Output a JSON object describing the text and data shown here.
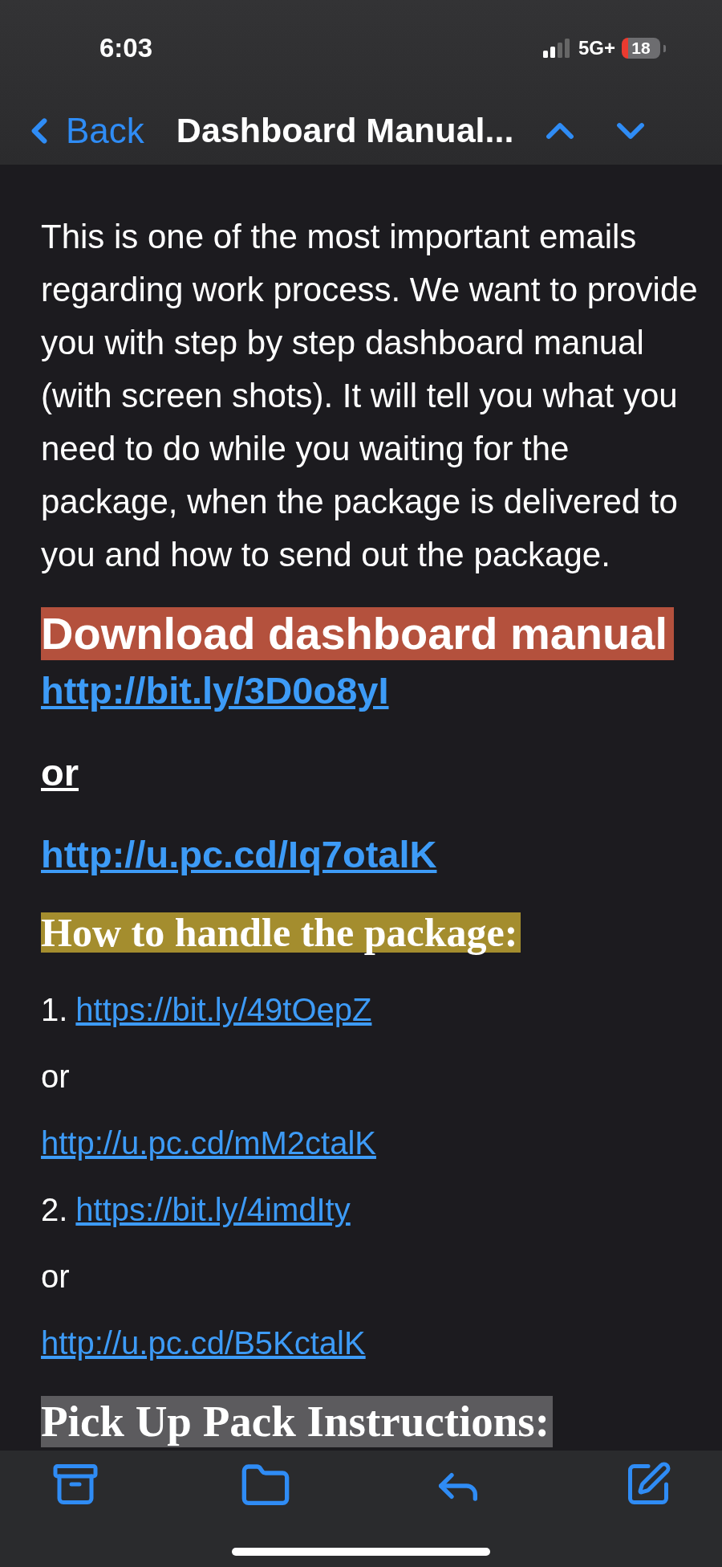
{
  "status_bar": {
    "time": "6:03",
    "network": "5G+",
    "battery": "18"
  },
  "nav": {
    "back": "Back",
    "title": "Dashboard Manual..."
  },
  "body": [
    {
      "kind": "paragraph",
      "text": "This is one of the most important emails regarding work process. We want to provide you with step by step dashboard manual (with screen shots). It will tell you what you need to do while you waiting for the package, when the package is delivered to you and how to send out the package."
    },
    {
      "kind": "sans_banner",
      "text": "Download dashboard manual",
      "color": "#b4513d"
    },
    {
      "kind": "link",
      "text": "http://bit.ly/3D0o8yI",
      "bold": true
    },
    {
      "kind": "text",
      "text": "or",
      "bold": true
    },
    {
      "kind": "link",
      "text": "http://u.pc.cd/Iq7otalK",
      "bold": true
    },
    {
      "kind": "serif_banner",
      "text": "How to handle the package:",
      "color": "#a48d2e"
    },
    {
      "kind": "numbered_link",
      "number": "1.",
      "text": "https://bit.ly/49tOepZ"
    },
    {
      "kind": "text",
      "text": "or",
      "bold": false
    },
    {
      "kind": "link",
      "text": "http://u.pc.cd/mM2ctalK",
      "bold": false
    },
    {
      "kind": "numbered_link",
      "number": "2.",
      "text": "https://bit.ly/4imdIty"
    },
    {
      "kind": "text",
      "text": "or",
      "bold": false
    },
    {
      "kind": "link",
      "text": "http://u.pc.cd/B5KctalK",
      "bold": false
    },
    {
      "kind": "serif_banner",
      "text": "Pick Up Pack Instructions:",
      "color": "#5c5b5e"
    }
  ]
}
